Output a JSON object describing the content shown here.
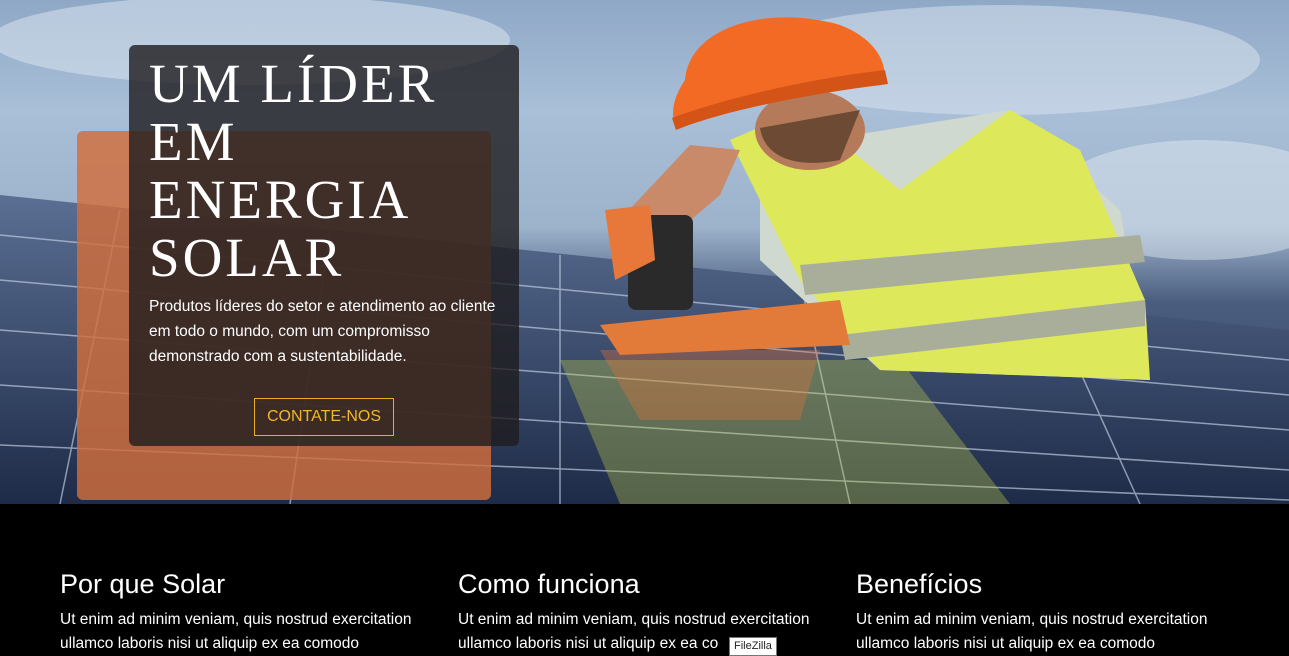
{
  "hero": {
    "title_lines": [
      "UM LÍDER",
      "EM",
      "ENERGIA",
      "SOLAR"
    ],
    "description": "Produtos líderes do setor e atendimento ao cliente em todo o mundo, com um compromisso demonstrado com a sustentabilidade.",
    "cta_label": "CONTATE-NOS",
    "image_subject": "solar-technician-photo"
  },
  "features": [
    {
      "title": "Por que Solar",
      "text": "Ut enim ad minim veniam, quis nostrud exercitation ullamco laboris nisi ut aliquip ex ea comodo"
    },
    {
      "title": "Como funciona",
      "text": "Ut enim ad minim veniam, quis nostrud exercitation ullamco laboris nisi ut aliquip ex ea co"
    },
    {
      "title": "Benefícios",
      "text": "Ut enim ad minim veniam, quis nostrud exercitation ullamco laboris nisi ut aliquip ex ea comodo"
    }
  ],
  "tooltip": "FileZilla",
  "colors": {
    "accent": "#f0b826",
    "orange_panel": "#d26e3c",
    "card": "#1e1c1e",
    "background": "#000000"
  }
}
